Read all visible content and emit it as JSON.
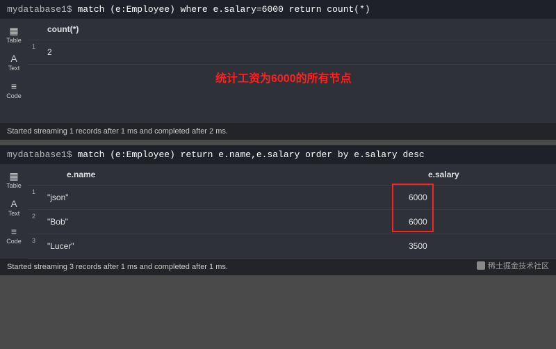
{
  "panel1": {
    "prompt": "mydatabase1$",
    "query": "match (e:Employee) where e.salary=6000 return count(*)",
    "header": "count(*)",
    "rows": [
      {
        "num": "1",
        "value": "2"
      }
    ],
    "annotation": "统计工资为6000的所有节点",
    "status": "Started streaming 1 records after 1 ms and completed after 2 ms."
  },
  "panel2": {
    "prompt": "mydatabase1$",
    "query": "match (e:Employee) return e.name,e.salary order by e.salary desc",
    "headers": {
      "name": "e.name",
      "salary": "e.salary"
    },
    "rows": [
      {
        "num": "1",
        "name": "\"json\"",
        "salary": "6000"
      },
      {
        "num": "2",
        "name": "\"Bob\"",
        "salary": "6000"
      },
      {
        "num": "3",
        "name": "\"Lucer\"",
        "salary": "3500"
      }
    ],
    "status": "Started streaming 3 records after 1 ms and completed after 1 ms."
  },
  "sidebar": {
    "table": "Table",
    "text": "Text",
    "code": "Code"
  },
  "watermark": "稀土掘金技术社区"
}
